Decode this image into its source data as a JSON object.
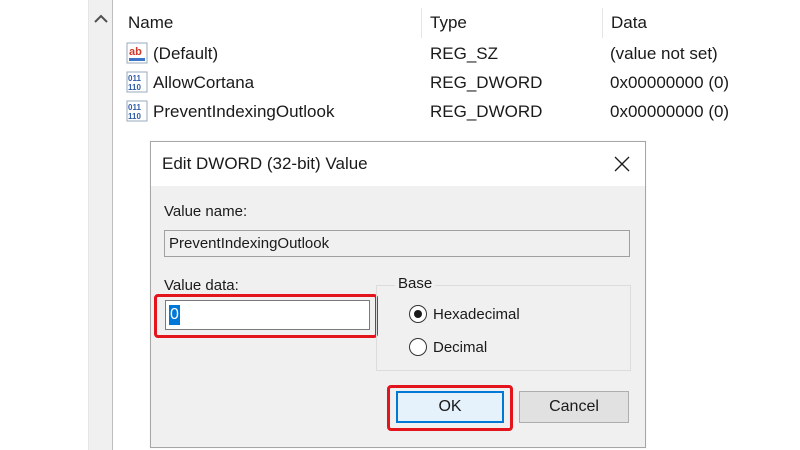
{
  "columns": {
    "name": "Name",
    "type": "Type",
    "data": "Data"
  },
  "rows": [
    {
      "name": "(Default)",
      "type": "REG_SZ",
      "data": "(value not set)",
      "icon": "string-value-icon"
    },
    {
      "name": "AllowCortana",
      "type": "REG_DWORD",
      "data": "0x00000000 (0)",
      "icon": "dword-value-icon"
    },
    {
      "name": "PreventIndexingOutlook",
      "type": "REG_DWORD",
      "data": "0x00000000 (0)",
      "icon": "dword-value-icon"
    }
  ],
  "dialog": {
    "title": "Edit DWORD (32-bit) Value",
    "value_name_label": "Value name:",
    "value_name": "PreventIndexingOutlook",
    "value_data_label": "Value data:",
    "value_data": "0",
    "base_label": "Base",
    "base_options": [
      "Hexadecimal",
      "Decimal"
    ],
    "base_selected": "Hexadecimal",
    "ok_label": "OK",
    "cancel_label": "Cancel"
  },
  "colors": {
    "highlight_box": "#e3141b",
    "selection": "#0078d7",
    "dialog_bg": "#f0f0f0"
  }
}
